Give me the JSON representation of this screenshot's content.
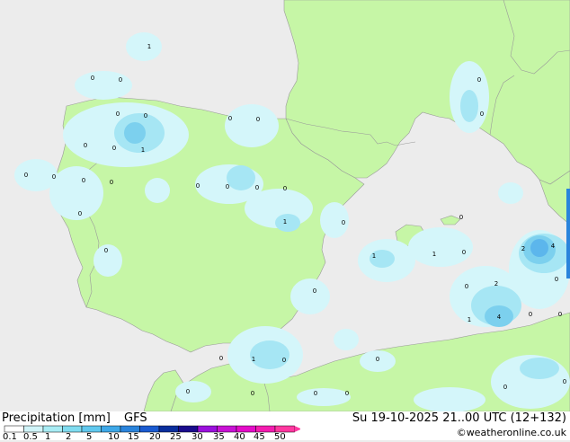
{
  "footer": {
    "title": "Precipitation [mm]",
    "model": "GFS",
    "valid_time": "Su 19-10-2025 21..00 UTC (12+132)",
    "credit": "©weatheronline.co.uk"
  },
  "legend": {
    "labels": [
      "0.1",
      "0.5",
      "1",
      "2",
      "5",
      "10",
      "15",
      "20",
      "25",
      "30",
      "35",
      "40",
      "45",
      "50"
    ],
    "colors": [
      "#ffffff",
      "#d0f4f8",
      "#a8ecf4",
      "#80dcf0",
      "#60c8ee",
      "#3ea8e8",
      "#2a84dc",
      "#1a5ad0",
      "#0a2e9c",
      "#1a0c8c",
      "#9a10dc",
      "#c812d4",
      "#e40cc8",
      "#f41cb0",
      "#ff38a0"
    ]
  },
  "colors": {
    "sea": "#ececec",
    "land": "#c6f6a6",
    "border": "#9a9a9a",
    "precip_light": "#d4f6fa",
    "precip_mid": "#a6e6f4",
    "precip_heavy": "#7cd0ee",
    "precip_core": "#5cb6ec"
  },
  "map": {
    "point_values": [
      {
        "v": "1"
      },
      {
        "v": "0"
      },
      {
        "v": "0"
      },
      {
        "v": "0"
      },
      {
        "v": "0"
      },
      {
        "v": "0"
      },
      {
        "v": "0"
      },
      {
        "v": "0"
      },
      {
        "v": "1"
      },
      {
        "v": "0"
      },
      {
        "v": "0"
      },
      {
        "v": "0"
      },
      {
        "v": "0"
      },
      {
        "v": "0"
      },
      {
        "v": "0"
      },
      {
        "v": "0"
      },
      {
        "v": "0"
      },
      {
        "v": "0"
      },
      {
        "v": "0"
      },
      {
        "v": "1"
      },
      {
        "v": "0"
      },
      {
        "v": "0"
      },
      {
        "v": "0"
      },
      {
        "v": "0"
      },
      {
        "v": "0"
      },
      {
        "v": "1"
      },
      {
        "v": "1"
      },
      {
        "v": "0"
      },
      {
        "v": "0"
      },
      {
        "v": "2"
      },
      {
        "v": "1"
      },
      {
        "v": "4"
      },
      {
        "v": "0"
      },
      {
        "v": "0"
      },
      {
        "v": "2"
      },
      {
        "v": "4"
      },
      {
        "v": "0"
      },
      {
        "v": "0"
      },
      {
        "v": "1"
      },
      {
        "v": "0"
      },
      {
        "v": "0"
      },
      {
        "v": "0"
      },
      {
        "v": "0"
      },
      {
        "v": "0"
      },
      {
        "v": "0"
      },
      {
        "v": "0"
      },
      {
        "v": "0"
      },
      {
        "v": "0"
      }
    ]
  }
}
